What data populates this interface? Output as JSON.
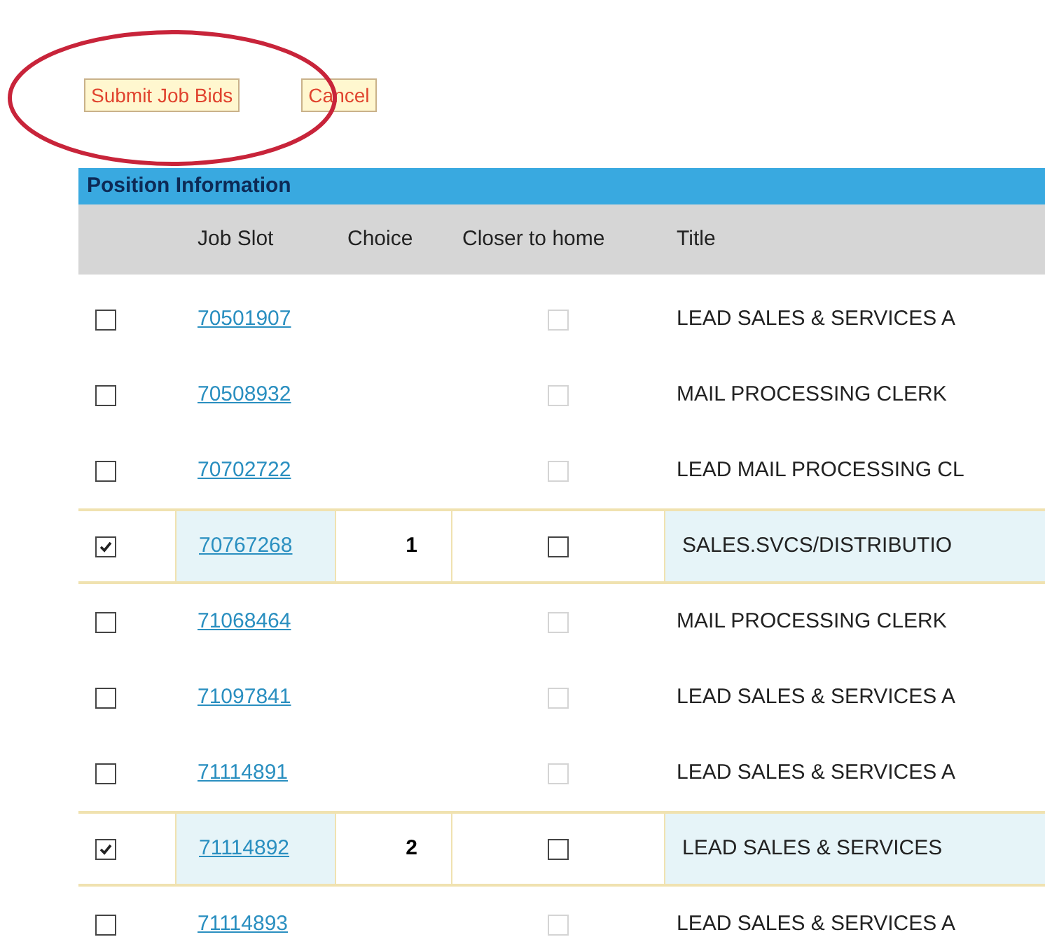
{
  "buttons": [
    {
      "label": "Submit Job Bids"
    },
    {
      "label": "Cancel"
    }
  ],
  "annotation": {
    "kind": "ellipse"
  },
  "table": {
    "caption": "Position Information",
    "columns": [
      "Job Slot",
      "Choice",
      "Closer to home",
      "Title"
    ],
    "rows": [
      {
        "checked": false,
        "job_slot": "70501907",
        "choice": "",
        "closer_to_home": {
          "checked": false,
          "disabled": true
        },
        "title": "LEAD SALES & SERVICES A"
      },
      {
        "checked": false,
        "job_slot": "70508932",
        "choice": "",
        "closer_to_home": {
          "checked": false,
          "disabled": true
        },
        "title": "MAIL PROCESSING CLERK"
      },
      {
        "checked": false,
        "job_slot": "70702722",
        "choice": "",
        "closer_to_home": {
          "checked": false,
          "disabled": true
        },
        "title": "LEAD MAIL PROCESSING CL"
      },
      {
        "checked": true,
        "job_slot": "70767268",
        "choice": "1",
        "closer_to_home": {
          "checked": false,
          "disabled": false
        },
        "title": "SALES.SVCS/DISTRIBUTIO"
      },
      {
        "checked": false,
        "job_slot": "71068464",
        "choice": "",
        "closer_to_home": {
          "checked": false,
          "disabled": true
        },
        "title": "MAIL PROCESSING CLERK"
      },
      {
        "checked": false,
        "job_slot": "71097841",
        "choice": "",
        "closer_to_home": {
          "checked": false,
          "disabled": true
        },
        "title": "LEAD SALES & SERVICES A"
      },
      {
        "checked": false,
        "job_slot": "71114891",
        "choice": "",
        "closer_to_home": {
          "checked": false,
          "disabled": true
        },
        "title": "LEAD SALES & SERVICES A"
      },
      {
        "checked": true,
        "job_slot": "71114892",
        "choice": "2",
        "closer_to_home": {
          "checked": false,
          "disabled": false
        },
        "title": "LEAD SALES & SERVICES"
      },
      {
        "checked": false,
        "job_slot": "71114893",
        "choice": "",
        "closer_to_home": {
          "checked": false,
          "disabled": true
        },
        "title": "LEAD SALES & SERVICES A"
      }
    ]
  }
}
